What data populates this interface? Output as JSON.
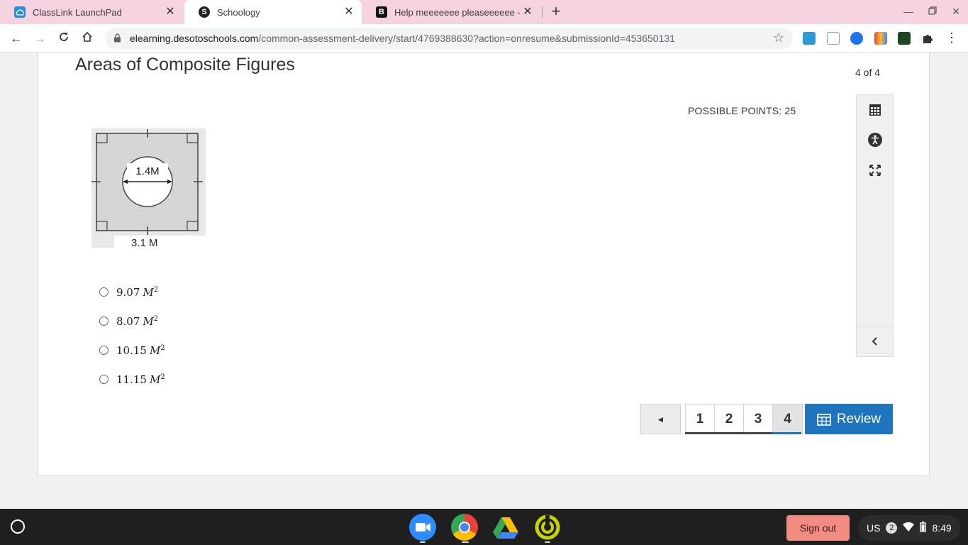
{
  "browser": {
    "tabs": [
      {
        "title": "ClassLink LaunchPad",
        "favicon": "classlink-icon",
        "active": false
      },
      {
        "title": "Schoology",
        "favicon": "schoology-icon",
        "active": true
      },
      {
        "title": "Help meeeeeee pleaseeeeee - Br",
        "favicon": "brainly-icon",
        "active": false
      }
    ],
    "url_host": "elearning.desotoschools.com",
    "url_path": "/common-assessment-delivery/start/4769388630?action=onresume&submissionId=453650131"
  },
  "assessment": {
    "title": "Areas of Composite Figures",
    "progress": "4 of 4",
    "points_label": "POSSIBLE POINTS: 25",
    "figure": {
      "circle_label": "1.4M",
      "side_label": "3.1 M"
    },
    "choices": [
      {
        "value": "9.07",
        "unit": "M",
        "exp": "2"
      },
      {
        "value": "8.07",
        "unit": "M",
        "exp": "2"
      },
      {
        "value": "10.15",
        "unit": "M",
        "exp": "2"
      },
      {
        "value": "11.15",
        "unit": "M",
        "exp": "2"
      }
    ],
    "pages": [
      "1",
      "2",
      "3",
      "4"
    ],
    "current_page": "4",
    "prev_glyph": "◄",
    "review_label": "Review"
  },
  "shelf": {
    "signout_label": "Sign out",
    "ime": "US",
    "notif_count": "2",
    "time": "8:49"
  },
  "colors": {
    "tabstrip": "#f6d3e1",
    "accent": "#1e74bd",
    "signout": "#f28b82"
  }
}
